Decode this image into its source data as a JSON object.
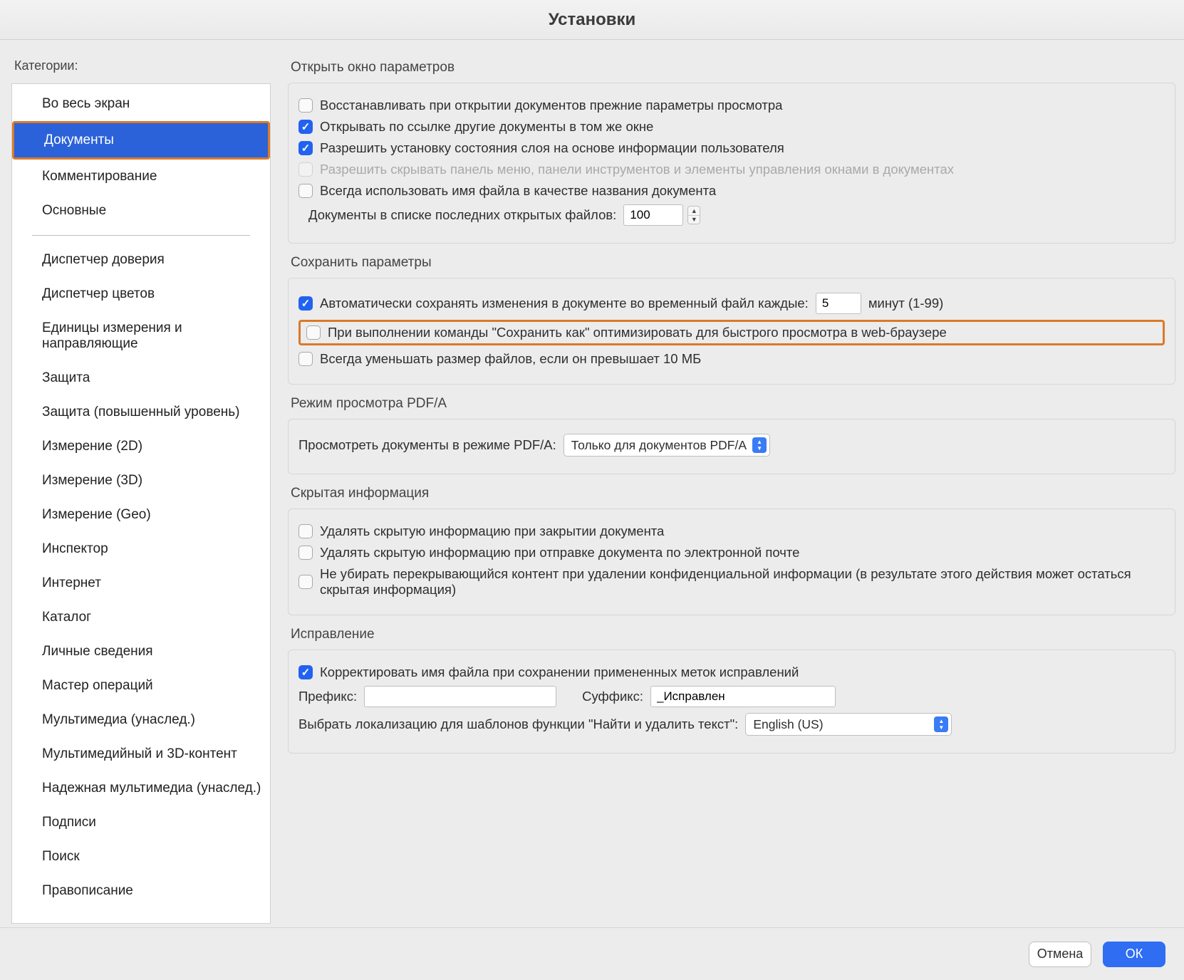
{
  "title": "Установки",
  "sidebar": {
    "label": "Категории:",
    "items": [
      "Во весь экран",
      "Документы",
      "Комментирование",
      "Основные",
      "Диспетчер доверия",
      "Диспетчер цветов",
      "Единицы измерения и направляющие",
      "Защита",
      "Защита (повышенный уровень)",
      "Измерение (2D)",
      "Измерение (3D)",
      "Измерение (Geo)",
      "Инспектор",
      "Интернет",
      "Каталог",
      "Личные сведения",
      "Мастер операций",
      "Мультимедиа (унаслед.)",
      "Мультимедийный и 3D-контент",
      "Надежная мультимедиа (унаслед.)",
      "Подписи",
      "Поиск",
      "Правописание"
    ],
    "selected_index": 1
  },
  "open_settings": {
    "title": "Открыть окно параметров",
    "restore": "Восстанавливать при открытии документов прежние параметры просмотра",
    "open_same_window": "Открывать по ссылке другие документы в том же окне",
    "allow_layer_state": "Разрешить установку состояния слоя на основе информации пользователя",
    "allow_hide_menubar": "Разрешить скрывать панель меню, панели инструментов и элементы управления окнами в документах",
    "always_use_filename": "Всегда использовать имя файла в качестве названия документа",
    "recent_label": "Документы в списке последних открытых файлов:",
    "recent_value": "100"
  },
  "save_settings": {
    "title": "Сохранить параметры",
    "autosave_label_pre": "Автоматически сохранять изменения в документе во временный файл каждые:",
    "autosave_value": "5",
    "autosave_label_post": "минут (1-99)",
    "optimize_web": "При выполнении команды \"Сохранить как\" оптимизировать для быстрого просмотра в web-браузере",
    "reduce_size": "Всегда уменьшать размер файлов, если он превышает 10 МБ"
  },
  "pdfa": {
    "title": "Режим просмотра PDF/A",
    "label": "Просмотреть документы в режиме PDF/A:",
    "value": "Только для документов PDF/A"
  },
  "hidden_info": {
    "title": "Скрытая информация",
    "remove_on_close": "Удалять скрытую информацию при закрытии документа",
    "remove_on_email": "Удалять скрытую информацию при отправке документа по электронной почте",
    "dont_remove_overlap": "Не убирать перекрывающийся контент при удалении конфиденциальной информации (в результате этого действия может остаться скрытая информация)"
  },
  "redaction": {
    "title": "Исправление",
    "adjust_filename": "Корректировать имя файла при сохранении примененных меток исправлений",
    "prefix_label": "Префикс:",
    "prefix_value": "",
    "suffix_label": "Суффикс:",
    "suffix_value": "_Исправлен",
    "locale_label": "Выбрать локализацию для шаблонов функции \"Найти и удалить текст\":",
    "locale_value": "English (US)"
  },
  "footer": {
    "cancel": "Отмена",
    "ok": "ОК"
  }
}
